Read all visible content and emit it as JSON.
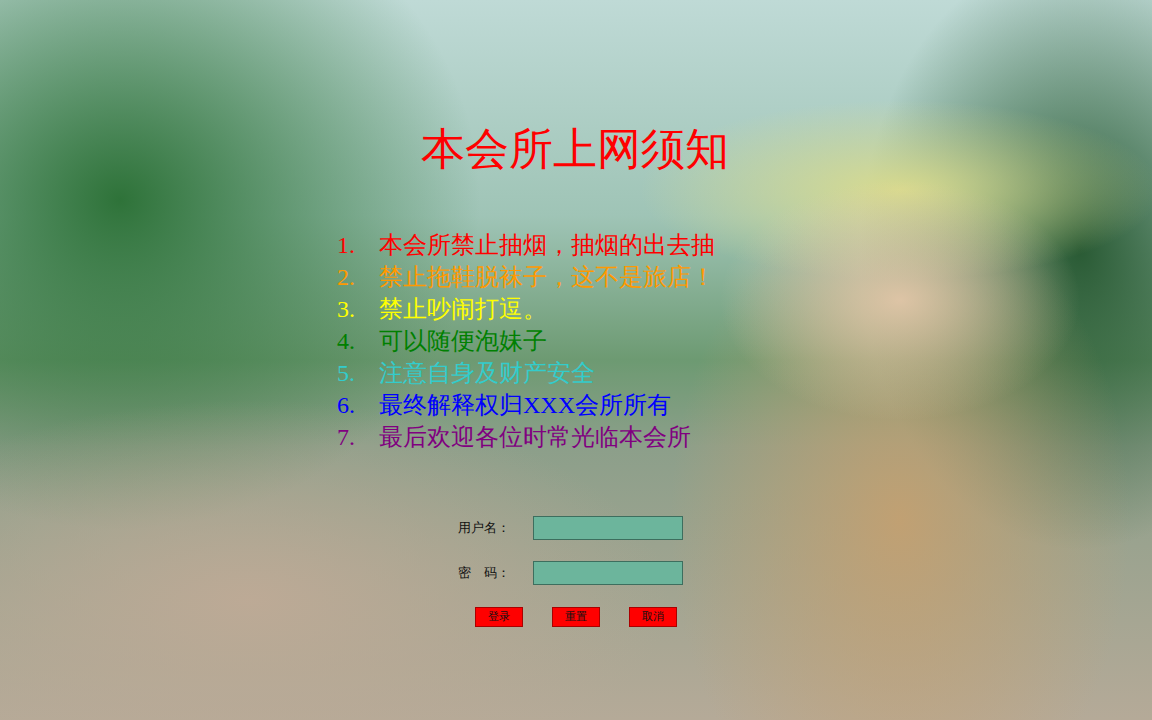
{
  "title": "本会所上网须知",
  "rules": [
    {
      "number": "1.",
      "text": "本会所禁止抽烟，抽烟的出去抽",
      "color": "#ff0000"
    },
    {
      "number": "2.",
      "text": "禁止拖鞋脱袜子，这不是旅店！",
      "color": "#ff9900"
    },
    {
      "number": "3.",
      "text": "禁止吵闹打逗。",
      "color": "#ffff00"
    },
    {
      "number": "4.",
      "text": "可以随便泡妹子",
      "color": "#008000"
    },
    {
      "number": "5.",
      "text": "注意自身及财产安全",
      "color": "#33cccc"
    },
    {
      "number": "6.",
      "text": "最终解释权归XXX会所所有",
      "color": "#0000ff"
    },
    {
      "number": "7.",
      "text": "最后欢迎各位时常光临本会所",
      "color": "#800080"
    }
  ],
  "form": {
    "fields": [
      {
        "label": "用户名："
      },
      {
        "label": "密　码："
      }
    ],
    "buttons": [
      "登录",
      "重置",
      "取消"
    ]
  }
}
